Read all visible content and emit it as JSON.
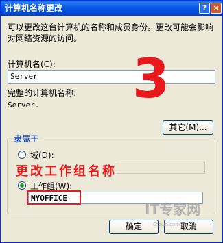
{
  "title": "计算机名称更改",
  "title_buttons": {
    "help": "?",
    "close": "×"
  },
  "intro": "可以更改这台计算机的名称和成员身份。更改可能会影响对网络资源的访问。",
  "computer_name_label": "计算机名(C):",
  "computer_name_value": "Server",
  "full_name_label": "完整的计算机名称:",
  "full_name_value": "Server.",
  "more_button": "其它(M)...",
  "member_of_label": "隶属于",
  "domain_label": "域(D):",
  "domain_value": "",
  "workgroup_label": "工作组(W):",
  "workgroup_value": "MYOFFICE",
  "ok_button": "确定",
  "cancel_button": "取消",
  "annotation_number": "3",
  "annotation_text": "更改工作组名称",
  "watermark": {
    "main": "IT专家网",
    "sub": "Ctocio.com.cn"
  },
  "colors": {
    "title_bar": "#0554e3",
    "dialog_bg": "#ece9d8",
    "annotation": "#e8191c"
  }
}
